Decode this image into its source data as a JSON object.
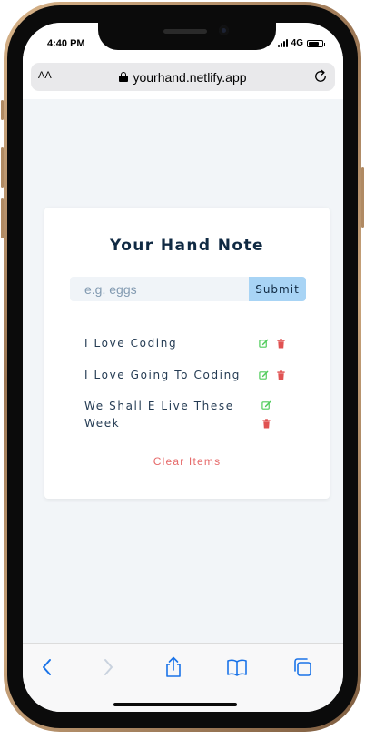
{
  "status_bar": {
    "time": "4:40 PM",
    "network": "4G",
    "battery_level": 0.8,
    "signal_icon": "cellular-signal-icon",
    "battery_icon": "battery-icon"
  },
  "browser": {
    "text_size_label": "AA",
    "url": "yourhand.netlify.app",
    "lock_icon": "lock-icon",
    "reload_icon": "reload-icon"
  },
  "app": {
    "title": "Your Hand Note",
    "input_placeholder": "e.g. eggs",
    "input_value": "",
    "submit_label": "Submit",
    "items": [
      {
        "text": "I Love Coding"
      },
      {
        "text": "I Love Going To Coding"
      },
      {
        "text": "We Shall E Live These Week"
      }
    ],
    "clear_label": "Clear Items",
    "edit_icon": "edit-icon",
    "delete_icon": "trash-icon"
  },
  "toolbar": {
    "icons": [
      "back-icon",
      "forward-icon",
      "share-icon",
      "bookmarks-icon",
      "tabs-icon"
    ]
  },
  "colors": {
    "title": "#102a43",
    "submit_bg": "#a8d4f5",
    "edit": "#4ecb5a",
    "delete": "#e05252",
    "clear": "#e66a6a",
    "link_blue": "#1a73e8",
    "page_bg": "#f2f5f8"
  }
}
